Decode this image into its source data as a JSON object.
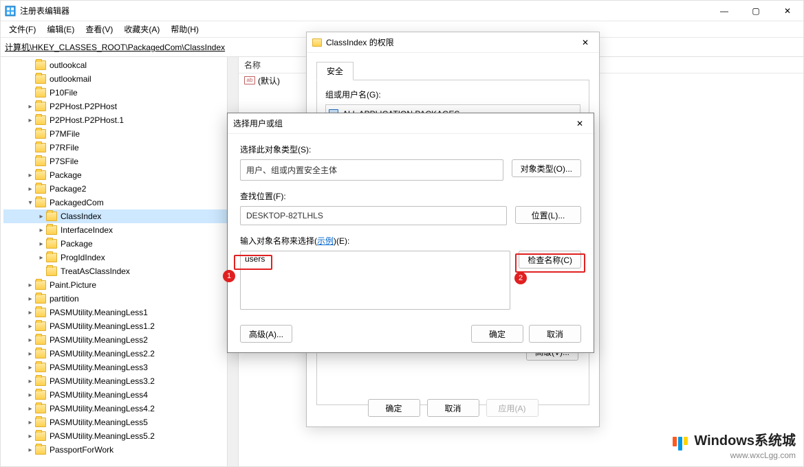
{
  "window": {
    "title": "注册表编辑器"
  },
  "menu": {
    "file": "文件(F)",
    "edit": "编辑(E)",
    "view": "查看(V)",
    "favorites": "收藏夹(A)",
    "help": "帮助(H)"
  },
  "address": "计算机\\HKEY_CLASSES_ROOT\\PackagedCom\\ClassIndex",
  "tree": {
    "items": [
      {
        "indent": 2,
        "chev": "none",
        "label": "outlookcal"
      },
      {
        "indent": 2,
        "chev": "none",
        "label": "outlookmail"
      },
      {
        "indent": 2,
        "chev": "none",
        "label": "P10File"
      },
      {
        "indent": 2,
        "chev": "closed",
        "label": "P2PHost.P2PHost"
      },
      {
        "indent": 2,
        "chev": "closed",
        "label": "P2PHost.P2PHost.1"
      },
      {
        "indent": 2,
        "chev": "none",
        "label": "P7MFile"
      },
      {
        "indent": 2,
        "chev": "none",
        "label": "P7RFile"
      },
      {
        "indent": 2,
        "chev": "none",
        "label": "P7SFile"
      },
      {
        "indent": 2,
        "chev": "closed",
        "label": "Package"
      },
      {
        "indent": 2,
        "chev": "closed",
        "label": "Package2"
      },
      {
        "indent": 2,
        "chev": "open",
        "label": "PackagedCom"
      },
      {
        "indent": 3,
        "chev": "closed",
        "label": "ClassIndex",
        "selected": true
      },
      {
        "indent": 3,
        "chev": "closed",
        "label": "InterfaceIndex"
      },
      {
        "indent": 3,
        "chev": "closed",
        "label": "Package"
      },
      {
        "indent": 3,
        "chev": "closed",
        "label": "ProgIdIndex"
      },
      {
        "indent": 3,
        "chev": "none",
        "label": "TreatAsClassIndex"
      },
      {
        "indent": 2,
        "chev": "closed",
        "label": "Paint.Picture"
      },
      {
        "indent": 2,
        "chev": "closed",
        "label": "partition"
      },
      {
        "indent": 2,
        "chev": "closed",
        "label": "PASMUtility.MeaningLess1"
      },
      {
        "indent": 2,
        "chev": "closed",
        "label": "PASMUtility.MeaningLess1.2"
      },
      {
        "indent": 2,
        "chev": "closed",
        "label": "PASMUtility.MeaningLess2"
      },
      {
        "indent": 2,
        "chev": "closed",
        "label": "PASMUtility.MeaningLess2.2"
      },
      {
        "indent": 2,
        "chev": "closed",
        "label": "PASMUtility.MeaningLess3"
      },
      {
        "indent": 2,
        "chev": "closed",
        "label": "PASMUtility.MeaningLess3.2"
      },
      {
        "indent": 2,
        "chev": "closed",
        "label": "PASMUtility.MeaningLess4"
      },
      {
        "indent": 2,
        "chev": "closed",
        "label": "PASMUtility.MeaningLess4.2"
      },
      {
        "indent": 2,
        "chev": "closed",
        "label": "PASMUtility.MeaningLess5"
      },
      {
        "indent": 2,
        "chev": "closed",
        "label": "PASMUtility.MeaningLess5.2"
      },
      {
        "indent": 2,
        "chev": "closed",
        "label": "PassportForWork"
      }
    ]
  },
  "list": {
    "name_header": "名称",
    "default_value": "(默认)"
  },
  "perm": {
    "title": "ClassIndex 的权限",
    "tab_security": "安全",
    "group_label": "组或用户名(G):",
    "group_entry": "ALL APPLICATION PACKAGES",
    "advanced_btn_partial": "高级(V)...",
    "ok": "确定",
    "cancel": "取消",
    "apply": "应用(A)"
  },
  "sel": {
    "title": "选择用户或组",
    "obj_type_label": "选择此对象类型(S):",
    "obj_type_value": "用户、组或内置安全主体",
    "obj_type_btn": "对象类型(O)...",
    "location_label": "查找位置(F):",
    "location_value": "DESKTOP-82TLHLS",
    "location_btn": "位置(L)...",
    "names_label_prefix": "输入对象名称来选择(",
    "names_label_link": "示例",
    "names_label_suffix": ")(E):",
    "names_value": "users",
    "check_btn": "检查名称(C)",
    "advanced_btn": "高级(A)...",
    "ok": "确定",
    "cancel": "取消"
  },
  "badges": {
    "one": "1",
    "two": "2"
  },
  "watermark": {
    "title": "Windows系统城",
    "url": "www.wxcLgg.com"
  }
}
